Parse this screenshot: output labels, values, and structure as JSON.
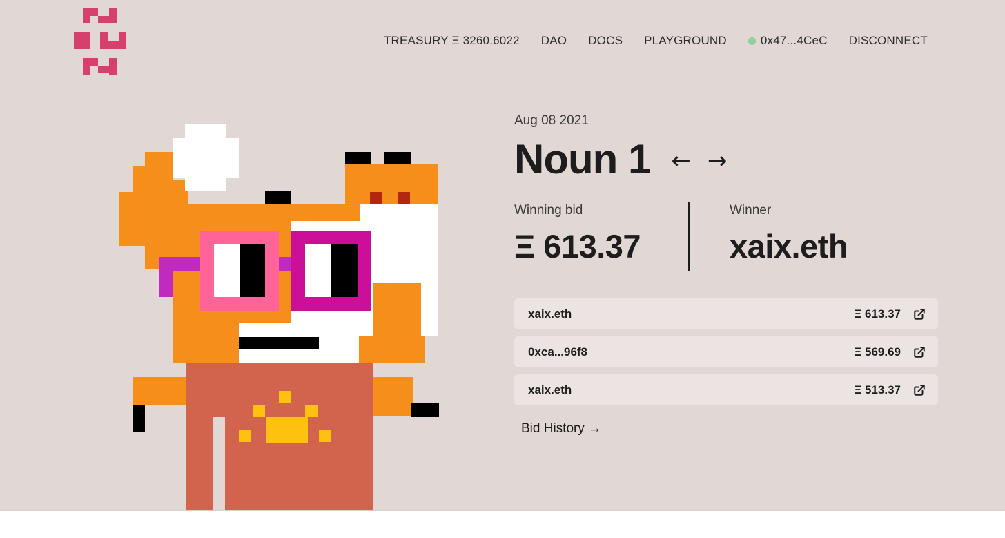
{
  "brand": {
    "logo_icon": "nouns-logo-icon",
    "color": "#d5416a"
  },
  "nav": {
    "treasury": "TREASURY Ξ 3260.6022",
    "dao": "DAO",
    "docs": "DOCS",
    "playground": "PLAYGROUND",
    "wallet": "0x47...4CeC",
    "wallet_status_color": "#8fcf9f",
    "disconnect": "DISCONNECT"
  },
  "auction": {
    "date": "Aug 08 2021",
    "title": "Noun 1",
    "prev_icon": "arrow-left-icon",
    "next_icon": "arrow-right-icon",
    "prev_label": "←",
    "next_label": "→",
    "winning_bid_label": "Winning bid",
    "winning_bid_value": "Ξ 613.37",
    "winner_label": "Winner",
    "winner_value": "xaix.eth"
  },
  "bids": [
    {
      "bidder": "xaix.eth",
      "amount": "Ξ 613.37"
    },
    {
      "bidder": "0xca...96f8",
      "amount": "Ξ 569.69"
    },
    {
      "bidder": "xaix.eth",
      "amount": "Ξ 513.37"
    }
  ],
  "bid_history_link": "Bid History →",
  "colors": {
    "background": "#e1d7d5",
    "bid_row": "#ebe4e3",
    "accent": "#d5416a"
  }
}
